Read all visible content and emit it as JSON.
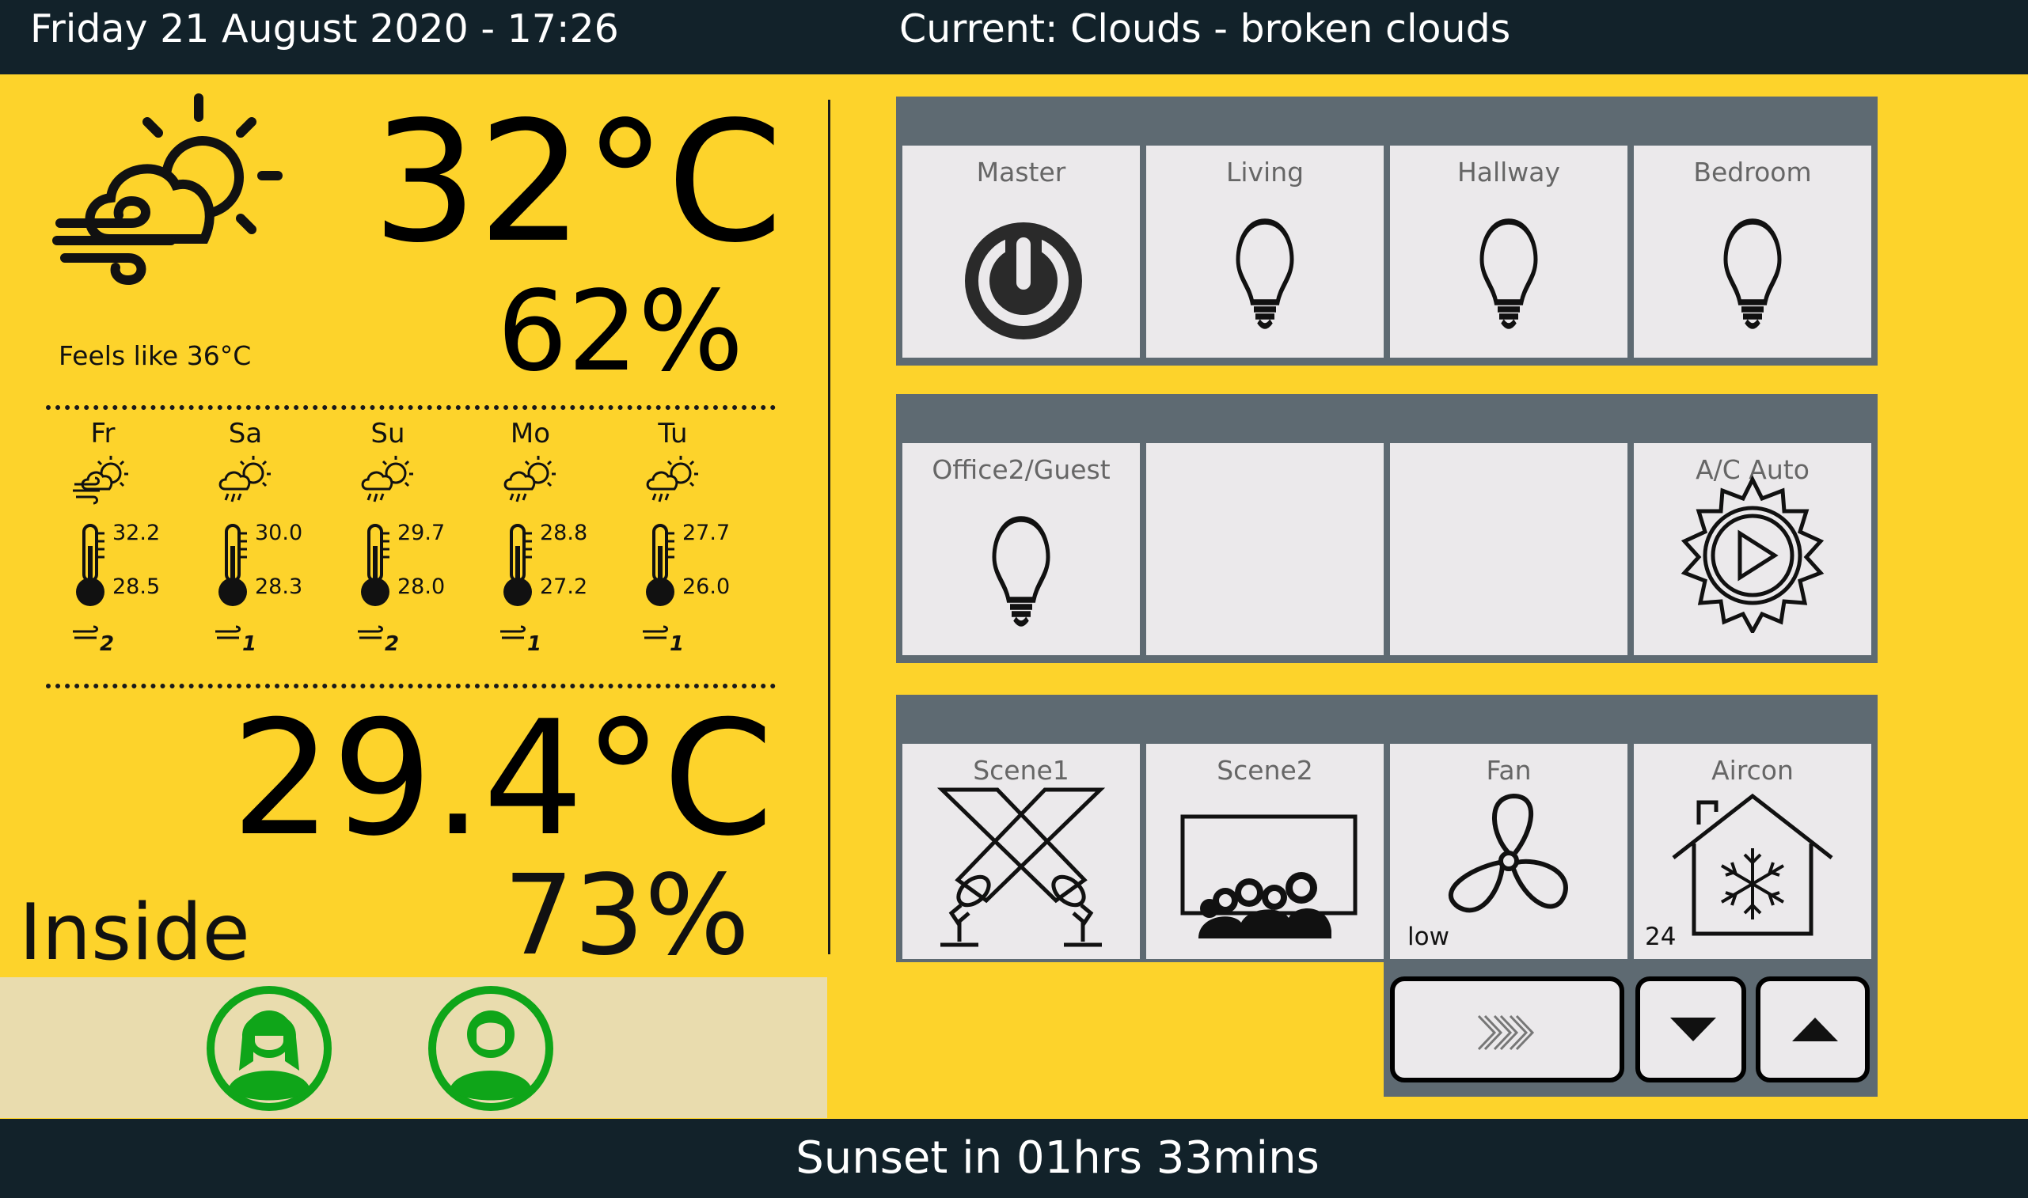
{
  "header": {
    "date": "Friday 21 August 2020  - 17:26",
    "current": "Current: Clouds - broken clouds"
  },
  "outside": {
    "temp": "32°C",
    "humidity": "62%",
    "feels_like": "Feels like 36°C",
    "icon": "sun-cloud-wind-icon"
  },
  "forecast": [
    {
      "day": "Fr",
      "high": "32.2",
      "low": "28.5",
      "wind": "2",
      "icon": "sun-cloud-wind-icon"
    },
    {
      "day": "Sa",
      "high": "30.0",
      "low": "28.3",
      "wind": "1",
      "icon": "sun-cloud-rain-icon"
    },
    {
      "day": "Su",
      "high": "29.7",
      "low": "28.0",
      "wind": "2",
      "icon": "sun-cloud-rain-icon"
    },
    {
      "day": "Mo",
      "high": "28.8",
      "low": "27.2",
      "wind": "1",
      "icon": "sun-cloud-rain-icon"
    },
    {
      "day": "Tu",
      "high": "27.7",
      "low": "26.0",
      "wind": "1",
      "icon": "sun-cloud-rain-icon"
    }
  ],
  "inside": {
    "temp": "29.4°C",
    "humidity": "73%",
    "label": "Inside"
  },
  "presence": [
    {
      "icon": "female-user-icon"
    },
    {
      "icon": "male-user-icon"
    }
  ],
  "panels": [
    {
      "tiles": [
        {
          "label": "Master",
          "icon": "power-icon"
        },
        {
          "label": "Living",
          "icon": "lightbulb-icon"
        },
        {
          "label": "Hallway",
          "icon": "lightbulb-icon"
        },
        {
          "label": "Bedroom",
          "icon": "lightbulb-icon"
        }
      ]
    },
    {
      "tiles": [
        {
          "label": "Office2/Guest",
          "icon": "lightbulb-icon"
        },
        {
          "label": "",
          "icon": ""
        },
        {
          "label": "",
          "icon": ""
        },
        {
          "label": "A/C Auto",
          "icon": "gear-play-icon"
        }
      ]
    },
    {
      "tiles": [
        {
          "label": "Scene1",
          "icon": "spotlights-icon"
        },
        {
          "label": "Scene2",
          "icon": "cinema-audience-icon"
        },
        {
          "label": "Fan",
          "icon": "fan-icon",
          "sub": "low"
        },
        {
          "label": "Aircon",
          "icon": "house-snowflake-icon",
          "sub": "24"
        }
      ]
    }
  ],
  "controls": {
    "next": "chevrons-right-icon",
    "down": "arrow-down-icon",
    "up": "arrow-up-icon"
  },
  "footer": {
    "sunset": "Sunset in 01hrs 33mins"
  },
  "colors": {
    "background": "#FDD32B",
    "bar": "#12222A",
    "panel": "#5E6A72",
    "tile": "#EBE9EB",
    "presence": "#0FA519"
  }
}
